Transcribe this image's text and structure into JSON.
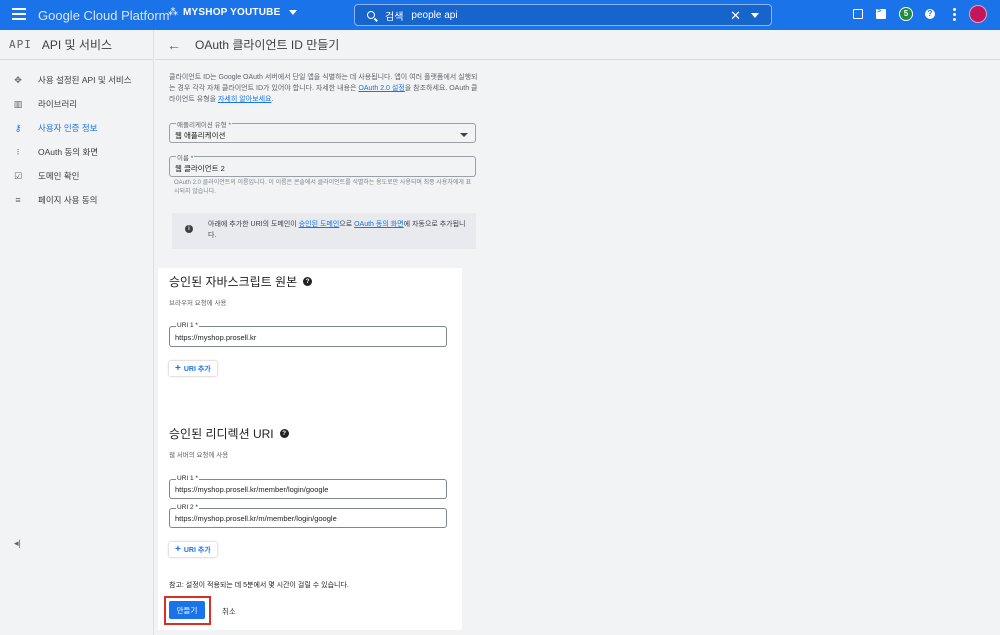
{
  "topbar": {
    "brand": "Google Cloud Platform",
    "project_name": "MYSHOP YOUTUBE",
    "search_label": "검색",
    "search_value": "people api",
    "badge_count": "5"
  },
  "sidebar": {
    "title": "API 및 서비스",
    "logo": "API",
    "items": [
      {
        "label": "사용 설정된 API 및 서비스",
        "icon": "diamond-icon"
      },
      {
        "label": "라이브러리",
        "icon": "library-icon"
      },
      {
        "label": "사용자 인증 정보",
        "icon": "key-icon",
        "active": true
      },
      {
        "label": "OAuth 동의 화면",
        "icon": "consent-icon"
      },
      {
        "label": "도메인 확인",
        "icon": "domain-check-icon"
      },
      {
        "label": "페이지 사용 동의",
        "icon": "page-usage-icon"
      }
    ],
    "collapse_glyph": "◂|"
  },
  "header": {
    "title": "OAuth 클라이언트 ID 만들기"
  },
  "intro": {
    "text1": "클라이언트 ID는 Google OAuth 서버에서 단일 앱을 식별하는 데 사용됩니다. 앱이 여러 플랫폼에서 실행되는 경우 각각 자체 클라이언트 ID가 있어야 합니다. 자세한 내용은 ",
    "link1": "OAuth 2.0 설정",
    "text2": "을 참조하세요. OAuth 클라이언트 유형을 ",
    "link2": "자세히 알아보세요",
    "text3": "."
  },
  "app_type": {
    "label": "애플리케이션 유형 *",
    "value": "웹 애플리케이션"
  },
  "name_field": {
    "label": "이름 *",
    "value": "웹 클라이언트 2",
    "hint": "OAuth 2.0 클라이언트의 이름입니다. 이 이름은 콘솔에서 클라이언트를 식별하는 용도로만 사용되며 최종 사용자에게 표시되지 않습니다."
  },
  "info": {
    "text1": "아래에 추가한 URI의 도메인이 ",
    "link1": "승인된 도메인",
    "text2": "으로 ",
    "link2": "OAuth 동의 화면",
    "text3": "에 자동으로 추가됩니다."
  },
  "js_origins": {
    "title": "승인된 자바스크립트 원본",
    "subtitle": "브라우저 요청에 사용",
    "uris": [
      {
        "label": "URI 1 *",
        "value": "https://myshop.prosell.kr"
      }
    ],
    "add_label": "URI 추가"
  },
  "redirect_uris": {
    "title": "승인된 리디렉션 URI",
    "subtitle": "웹 서버의 요청에 사용",
    "uris": [
      {
        "label": "URI 1 *",
        "value": "https://myshop.prosell.kr/member/login/google"
      },
      {
        "label": "URI 2 *",
        "value": "https://myshop.prosell.kr/m/member/login/google"
      }
    ],
    "add_label": "URI 추가"
  },
  "footer": {
    "note": "참고: 설정이 적용되는 데 5분에서 몇 시간이 걸릴 수 있습니다.",
    "create_label": "만들기",
    "cancel_label": "취소"
  },
  "colors": {
    "primary": "#1a73e8",
    "highlight": "#d93025",
    "avatar": "#c2185b",
    "badge": "#1e8e3e"
  }
}
